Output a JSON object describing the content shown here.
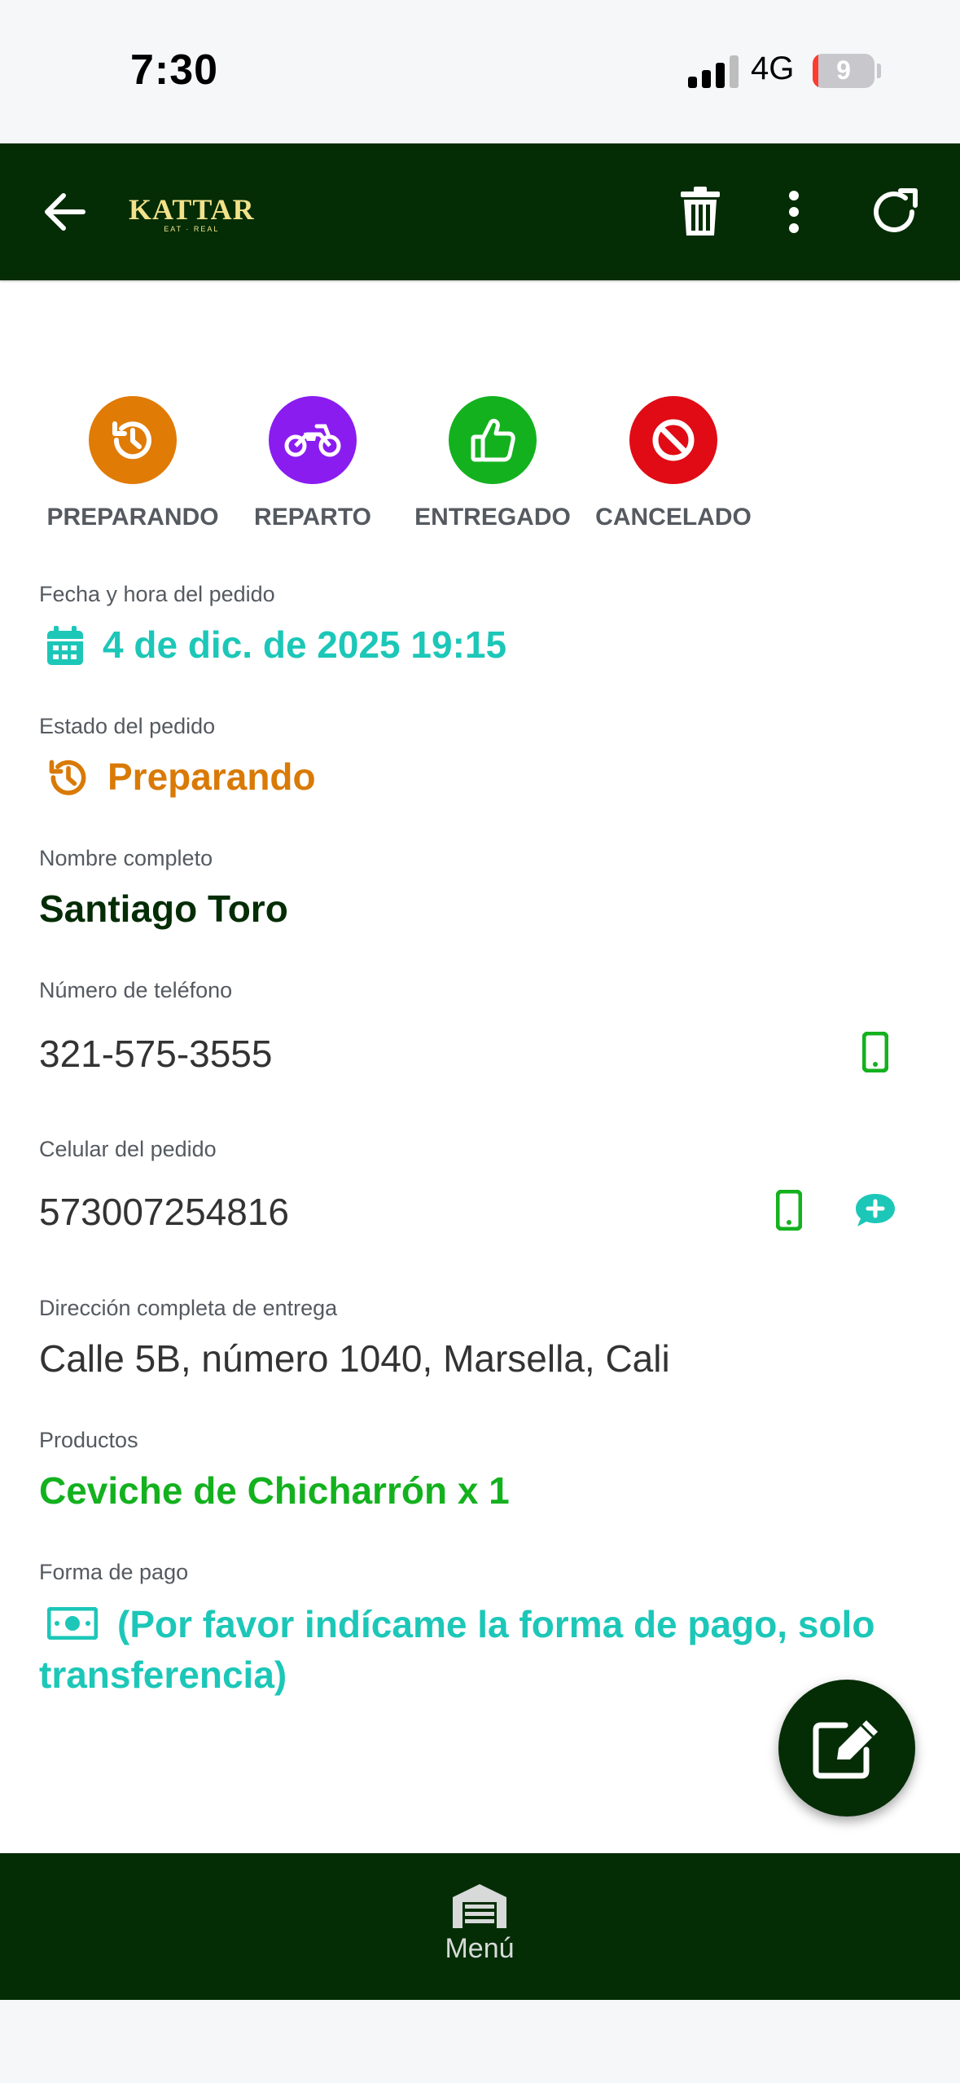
{
  "status_bar": {
    "time": "7:30",
    "network": "4G",
    "battery": "9",
    "battery_level": 0.09
  },
  "app_bar": {
    "logo_text": "KATTAR",
    "logo_sub": "EAT · REAL",
    "icons": [
      "back-arrow-icon",
      "trash-icon",
      "more-vertical-icon",
      "refresh-icon"
    ]
  },
  "statuses": [
    {
      "label": "PREPARANDO",
      "color": "#e07b06",
      "icon": "history-icon"
    },
    {
      "label": "REPARTO",
      "color": "#8a1cf0",
      "icon": "motorcycle-icon"
    },
    {
      "label": "ENTREGADO",
      "color": "#14b11f",
      "icon": "thumbs-up-icon"
    },
    {
      "label": "CANCELADO",
      "color": "#e00b14",
      "icon": "ban-icon"
    }
  ],
  "order": {
    "date_label": "Fecha y hora del pedido",
    "date_value": "4 de dic. de 2025 19:15",
    "state_label": "Estado del pedido",
    "state_value": "Preparando",
    "name_label": "Nombre completo",
    "name_value": "Santiago Toro",
    "phone_label": "Número de teléfono",
    "phone_value": "321-575-3555",
    "cell_label": "Celular del pedido",
    "cell_value": "573007254816",
    "address_label": "Dirección completa de entrega",
    "address_value": "Calle 5B, número 1040, Marsella, Cali",
    "products_label": "Productos",
    "products_value": "Ceviche de Chicharrón x 1",
    "payment_label": "Forma de pago",
    "payment_line1": "(Por favor indícame la forma de pago, solo",
    "payment_line2": "transferencia)"
  },
  "colors": {
    "dark_green": "#042d06",
    "teal": "#1cc7b8",
    "orange": "#d97a06",
    "green": "#14b11f"
  },
  "bottom_nav": {
    "menu_label": "Menú"
  }
}
